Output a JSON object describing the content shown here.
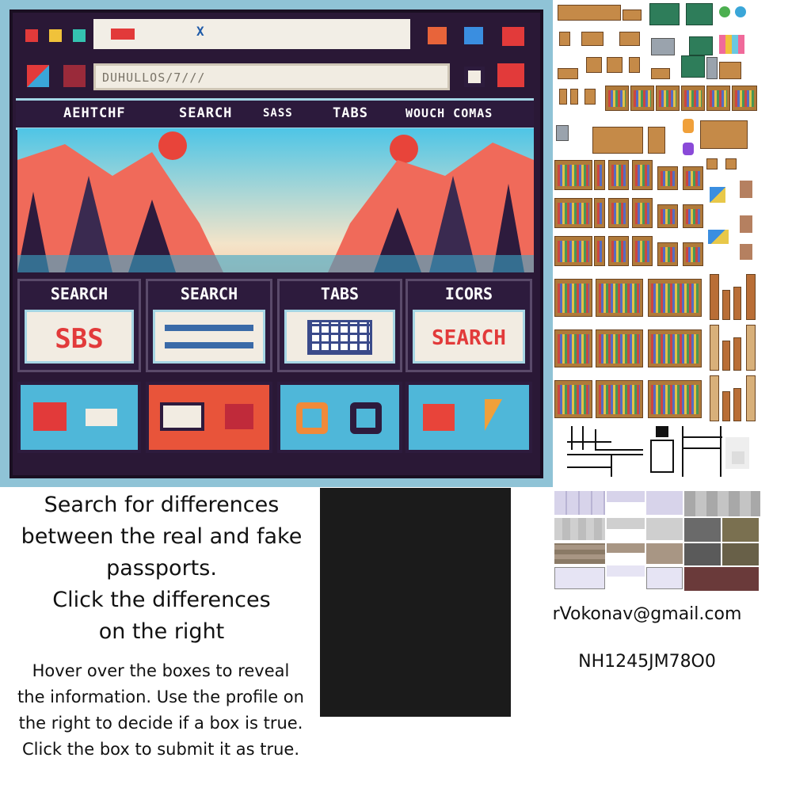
{
  "mockup": {
    "url_text": "DUHULLOS/7///",
    "tab_close": "X",
    "nav_items": [
      "AEHTCHF",
      "SEARCH",
      "SASS",
      "TABS",
      "WOUCH COMAS"
    ],
    "cards_top": [
      {
        "title": "SEARCH",
        "content": "SBS"
      },
      {
        "title": "SEARCH",
        "content": ""
      },
      {
        "title": "TABS",
        "content": ""
      },
      {
        "title": "ICORS",
        "content": "SEARCH"
      }
    ],
    "colors": {
      "frame": "#2a1836",
      "accent_red": "#e23a3a",
      "sky": "#4ec5e6"
    }
  },
  "instructions": {
    "title_lines": [
      "Search for differences",
      "between the real and fake",
      "passports.",
      "Click the differences",
      "on the right"
    ],
    "body": "Hover over the boxes to reveal the information. Use the profile on the right to decide if a box is true. Click the box to submit it as true."
  },
  "profile": {
    "email": "rVokonav@gmail.com",
    "passport_number": "NH1245JM78O0"
  }
}
